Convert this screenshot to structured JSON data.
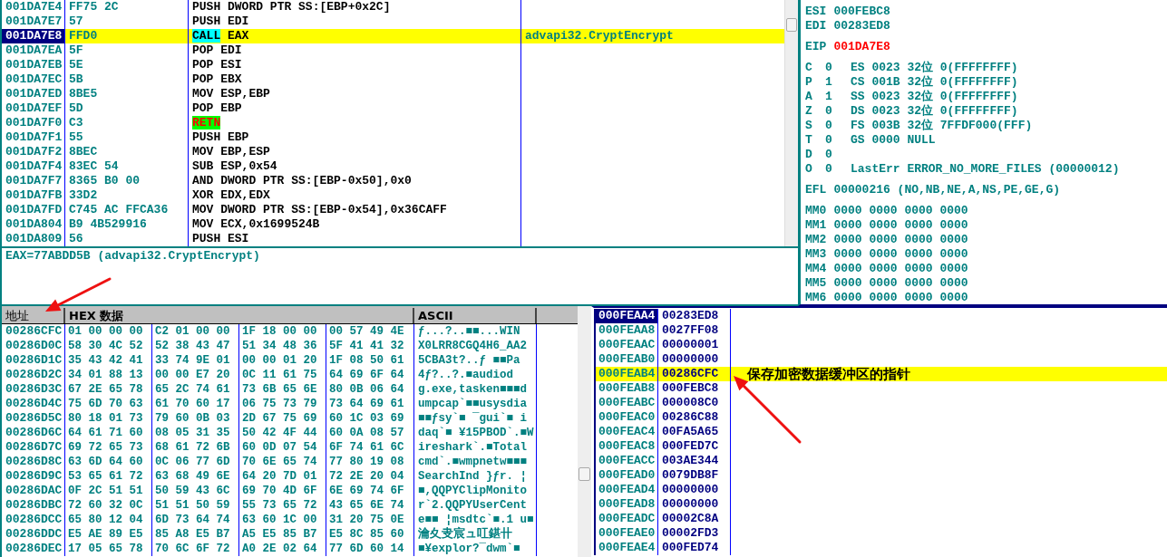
{
  "disassembly": {
    "rows": [
      {
        "address": "001DA7E4",
        "hex": "FF75 2C",
        "mnemonic": "PUSH",
        "operands": "DWORD PTR SS:[EBP+0x2C]",
        "kind": "plain",
        "selected": false
      },
      {
        "address": "001DA7E7",
        "hex": "57",
        "mnemonic": "PUSH",
        "operands": "EDI",
        "kind": "plain",
        "selected": false
      },
      {
        "address": "001DA7E8",
        "hex": "FFD0",
        "mnemonic": "CALL",
        "operands": "EAX",
        "kind": "call",
        "selected": true,
        "comment": "advapi32.CryptEncrypt"
      },
      {
        "address": "001DA7EA",
        "hex": "5F",
        "mnemonic": "POP",
        "operands": "EDI",
        "kind": "plain",
        "selected": false
      },
      {
        "address": "001DA7EB",
        "hex": "5E",
        "mnemonic": "POP",
        "operands": "ESI",
        "kind": "plain",
        "selected": false
      },
      {
        "address": "001DA7EC",
        "hex": "5B",
        "mnemonic": "POP",
        "operands": "EBX",
        "kind": "plain",
        "selected": false
      },
      {
        "address": "001DA7ED",
        "hex": "8BE5",
        "mnemonic": "MOV",
        "operands": "ESP,EBP",
        "kind": "plain",
        "selected": false
      },
      {
        "address": "001DA7EF",
        "hex": "5D",
        "mnemonic": "POP",
        "operands": "EBP",
        "kind": "plain",
        "selected": false
      },
      {
        "address": "001DA7F0",
        "hex": "C3",
        "mnemonic": "RETN",
        "kind": "ret",
        "selected": false
      },
      {
        "address": "001DA7F1",
        "hex": "55",
        "mnemonic": "PUSH",
        "operands": "EBP",
        "kind": "plain",
        "selected": false
      },
      {
        "address": "001DA7F2",
        "hex": "8BEC",
        "mnemonic": "MOV",
        "operands": "EBP,ESP",
        "kind": "plain",
        "selected": false
      },
      {
        "address": "001DA7F4",
        "hex": "83EC 54",
        "mnemonic": "SUB",
        "operands": "ESP,0x54",
        "kind": "plain",
        "selected": false
      },
      {
        "address": "001DA7F7",
        "hex": "8365 B0 00",
        "mnemonic": "AND",
        "operands": "DWORD PTR SS:[EBP-0x50],0x0",
        "kind": "plain",
        "selected": false
      },
      {
        "address": "001DA7FB",
        "hex": "33D2",
        "mnemonic": "XOR",
        "operands": "EDX,EDX",
        "kind": "plain",
        "selected": false
      },
      {
        "address": "001DA7FD",
        "hex": "C745 AC FFCA36",
        "mnemonic": "MOV",
        "operands": "DWORD PTR SS:[EBP-0x54],0x36CAFF",
        "kind": "plain",
        "selected": false
      },
      {
        "address": "001DA804",
        "hex": "B9 4B529916",
        "mnemonic": "MOV",
        "operands": "ECX,0x1699524B",
        "kind": "plain",
        "selected": false
      },
      {
        "address": "001DA809",
        "hex": "56",
        "mnemonic": "PUSH",
        "operands": "ESI",
        "kind": "plain",
        "selected": false
      }
    ]
  },
  "info_line": "EAX=77ABDD5B (advapi32.CryptEncrypt)",
  "registers": [
    [
      {
        "kind": "register",
        "name": "ESI",
        "value": "000FEBC8",
        "changed": false
      },
      {
        "kind": "register",
        "name": "EDI",
        "value": "00283ED8",
        "changed": false
      }
    ],
    [
      {
        "kind": "register",
        "name": "EIP",
        "value": "001DA7E8",
        "changed": true
      }
    ],
    [
      {
        "kind": "flag",
        "flag": "C",
        "bit": "0",
        "detail": "ES 0023 32位 0(FFFFFFFF)"
      },
      {
        "kind": "flag",
        "flag": "P",
        "bit": "1",
        "detail": "CS 001B 32位 0(FFFFFFFF)"
      },
      {
        "kind": "flag",
        "flag": "A",
        "bit": "1",
        "detail": "SS 0023 32位 0(FFFFFFFF)"
      },
      {
        "kind": "flag",
        "flag": "Z",
        "bit": "0",
        "detail": "DS 0023 32位 0(FFFFFFFF)"
      },
      {
        "kind": "flag",
        "flag": "S",
        "bit": "0",
        "detail": "FS 003B 32位 7FFDF000(FFF)"
      },
      {
        "kind": "flag",
        "flag": "T",
        "bit": "0",
        "detail": "GS 0000 NULL"
      },
      {
        "kind": "flag",
        "flag": "D",
        "bit": "0"
      },
      {
        "kind": "flag",
        "flag": "O",
        "bit": "0",
        "detail": "LastErr ERROR_NO_MORE_FILES (00000012)"
      }
    ],
    [
      {
        "kind": "register",
        "name": "EFL",
        "value": "00000216 (NO,NB,NE,A,NS,PE,GE,G)",
        "changed": false
      }
    ],
    [
      {
        "kind": "register",
        "name": "MM0",
        "value": "0000 0000 0000 0000",
        "changed": false
      },
      {
        "kind": "register",
        "name": "MM1",
        "value": "0000 0000 0000 0000",
        "changed": false
      },
      {
        "kind": "register",
        "name": "MM2",
        "value": "0000 0000 0000 0000",
        "changed": false
      },
      {
        "kind": "register",
        "name": "MM3",
        "value": "0000 0000 0000 0000",
        "changed": false
      },
      {
        "kind": "register",
        "name": "MM4",
        "value": "0000 0000 0000 0000",
        "changed": false
      },
      {
        "kind": "register",
        "name": "MM5",
        "value": "0000 0000 0000 0000",
        "changed": false
      },
      {
        "kind": "register",
        "name": "MM6",
        "value": "0000 0000 0000 0000",
        "changed": false
      }
    ]
  ],
  "dump": {
    "columns": [
      "地址",
      "HEX 数据",
      "ASCII"
    ],
    "rows": [
      {
        "address": "00286CFC",
        "hex": [
          "01 00 00 00",
          "C2 01 00 00",
          "1F 18 00 00",
          "00 57 49 4E"
        ],
        "ascii": "ƒ...?..■■...WIN"
      },
      {
        "address": "00286D0C",
        "hex": [
          "58 30 4C 52",
          "52 38 43 47",
          "51 34 48 36",
          "5F 41 41 32"
        ],
        "ascii": "X0LRR8CGQ4H6_AA2"
      },
      {
        "address": "00286D1C",
        "hex": [
          "35 43 42 41",
          "33 74 9E 01",
          "00 00 01 20",
          "1F 08 50 61"
        ],
        "ascii": "5CBA3t?..ƒ ■■Pa"
      },
      {
        "address": "00286D2C",
        "hex": [
          "34 01 88 13",
          "00 00 E7 20",
          "0C 11 61 75",
          "64 69 6F 64"
        ],
        "ascii": "4ƒ?..?.■audiod"
      },
      {
        "address": "00286D3C",
        "hex": [
          "67 2E 65 78",
          "65 2C 74 61",
          "73 6B 65 6E",
          "80 0B 06 64"
        ],
        "ascii": "g.exe,tasken■■■d"
      },
      {
        "address": "00286D4C",
        "hex": [
          "75 6D 70 63",
          "61 70 60 17",
          "06 75 73 79",
          "73 64 69 61"
        ],
        "ascii": "umpcap`■■usysdia"
      },
      {
        "address": "00286D5C",
        "hex": [
          "80 18 01 73",
          "79 60 0B 03",
          "2D 67 75 69",
          "60 1C 03 69"
        ],
        "ascii": "■■ƒsy`■ ‾gui`■ i"
      },
      {
        "address": "00286D6C",
        "hex": [
          "64 61 71 60",
          "08 05 31 35",
          "50 42 4F 44",
          "60 0A 08 57"
        ],
        "ascii": "daq`■ ¥15PBOD`.■W"
      },
      {
        "address": "00286D7C",
        "hex": [
          "69 72 65 73",
          "68 61 72 6B",
          "60 0D 07 54",
          "6F 74 61 6C"
        ],
        "ascii": "ireshark`.■Total"
      },
      {
        "address": "00286D8C",
        "hex": [
          "63 6D 64 60",
          "0C 06 77 6D",
          "70 6E 65 74",
          "77 80 19 08"
        ],
        "ascii": "cmd`.■wmpnetw■■■"
      },
      {
        "address": "00286D9C",
        "hex": [
          "53 65 61 72",
          "63 68 49 6E",
          "64 20 7D 01",
          "72 2E 20 04"
        ],
        "ascii": "SearchInd }ƒr. ¦"
      },
      {
        "address": "00286DAC",
        "hex": [
          "0F 2C 51 51",
          "50 59 43 6C",
          "69 70 4D 6F",
          "6E 69 74 6F"
        ],
        "ascii": "■,QQPYClipMonito"
      },
      {
        "address": "00286DBC",
        "hex": [
          "72 60 32 0C",
          "51 51 50 59",
          "55 73 65 72",
          "43 65 6E 74"
        ],
        "ascii": "r`2.QQPYUserCent"
      },
      {
        "address": "00286DCC",
        "hex": [
          "65 80 12 04",
          "6D 73 64 74",
          "63 60 1C 00",
          "31 20 75 0E"
        ],
        "ascii": "e■■ ¦msdtc`■.1 u■"
      },
      {
        "address": "00286DDC",
        "hex": [
          "E5 AE 89 E5",
          "85 A8 E5 B7",
          "A5 E5 85 B7",
          "E5 8C 85 60"
        ],
        "ascii": "瀹夊叏宸ュ叿鍖卄"
      },
      {
        "address": "00286DEC",
        "hex": [
          "17 05 65 78",
          "70 6C 6F 72",
          "A0 2E 02 64",
          "77 6D 60 14"
        ],
        "ascii": "■¥explor?‾dwm`■"
      }
    ]
  },
  "stack": {
    "rows": [
      {
        "address": "000FEAA4",
        "value": "00283ED8",
        "selected": true,
        "highlighted": false
      },
      {
        "address": "000FEAA8",
        "value": "0027FF08",
        "selected": false,
        "highlighted": false
      },
      {
        "address": "000FEAAC",
        "value": "00000001",
        "selected": false,
        "highlighted": false
      },
      {
        "address": "000FEAB0",
        "value": "00000000",
        "selected": false,
        "highlighted": false
      },
      {
        "address": "000FEAB4",
        "value": "00286CFC",
        "selected": false,
        "highlighted": true,
        "note": "保存加密数据缓冲区的指针"
      },
      {
        "address": "000FEAB8",
        "value": "000FEBC8",
        "selected": false,
        "highlighted": false
      },
      {
        "address": "000FEABC",
        "value": "000008C0",
        "selected": false,
        "highlighted": false
      },
      {
        "address": "000FEAC0",
        "value": "00286C88",
        "selected": false,
        "highlighted": false
      },
      {
        "address": "000FEAC4",
        "value": "00FA5A65",
        "selected": false,
        "highlighted": false
      },
      {
        "address": "000FEAC8",
        "value": "000FED7C",
        "selected": false,
        "highlighted": false
      },
      {
        "address": "000FEACC",
        "value": "003AE344",
        "selected": false,
        "highlighted": false
      },
      {
        "address": "000FEAD0",
        "value": "0079DB8F",
        "selected": false,
        "highlighted": false
      },
      {
        "address": "000FEAD4",
        "value": "00000000",
        "selected": false,
        "highlighted": false
      },
      {
        "address": "000FEAD8",
        "value": "00000000",
        "selected": false,
        "highlighted": false
      },
      {
        "address": "000FEADC",
        "value": "00002C8A",
        "selected": false,
        "highlighted": false
      },
      {
        "address": "000FEAE0",
        "value": "00002FD3",
        "selected": false,
        "highlighted": false
      },
      {
        "address": "000FEAE4",
        "value": "000FED74",
        "selected": false,
        "highlighted": false
      }
    ]
  }
}
